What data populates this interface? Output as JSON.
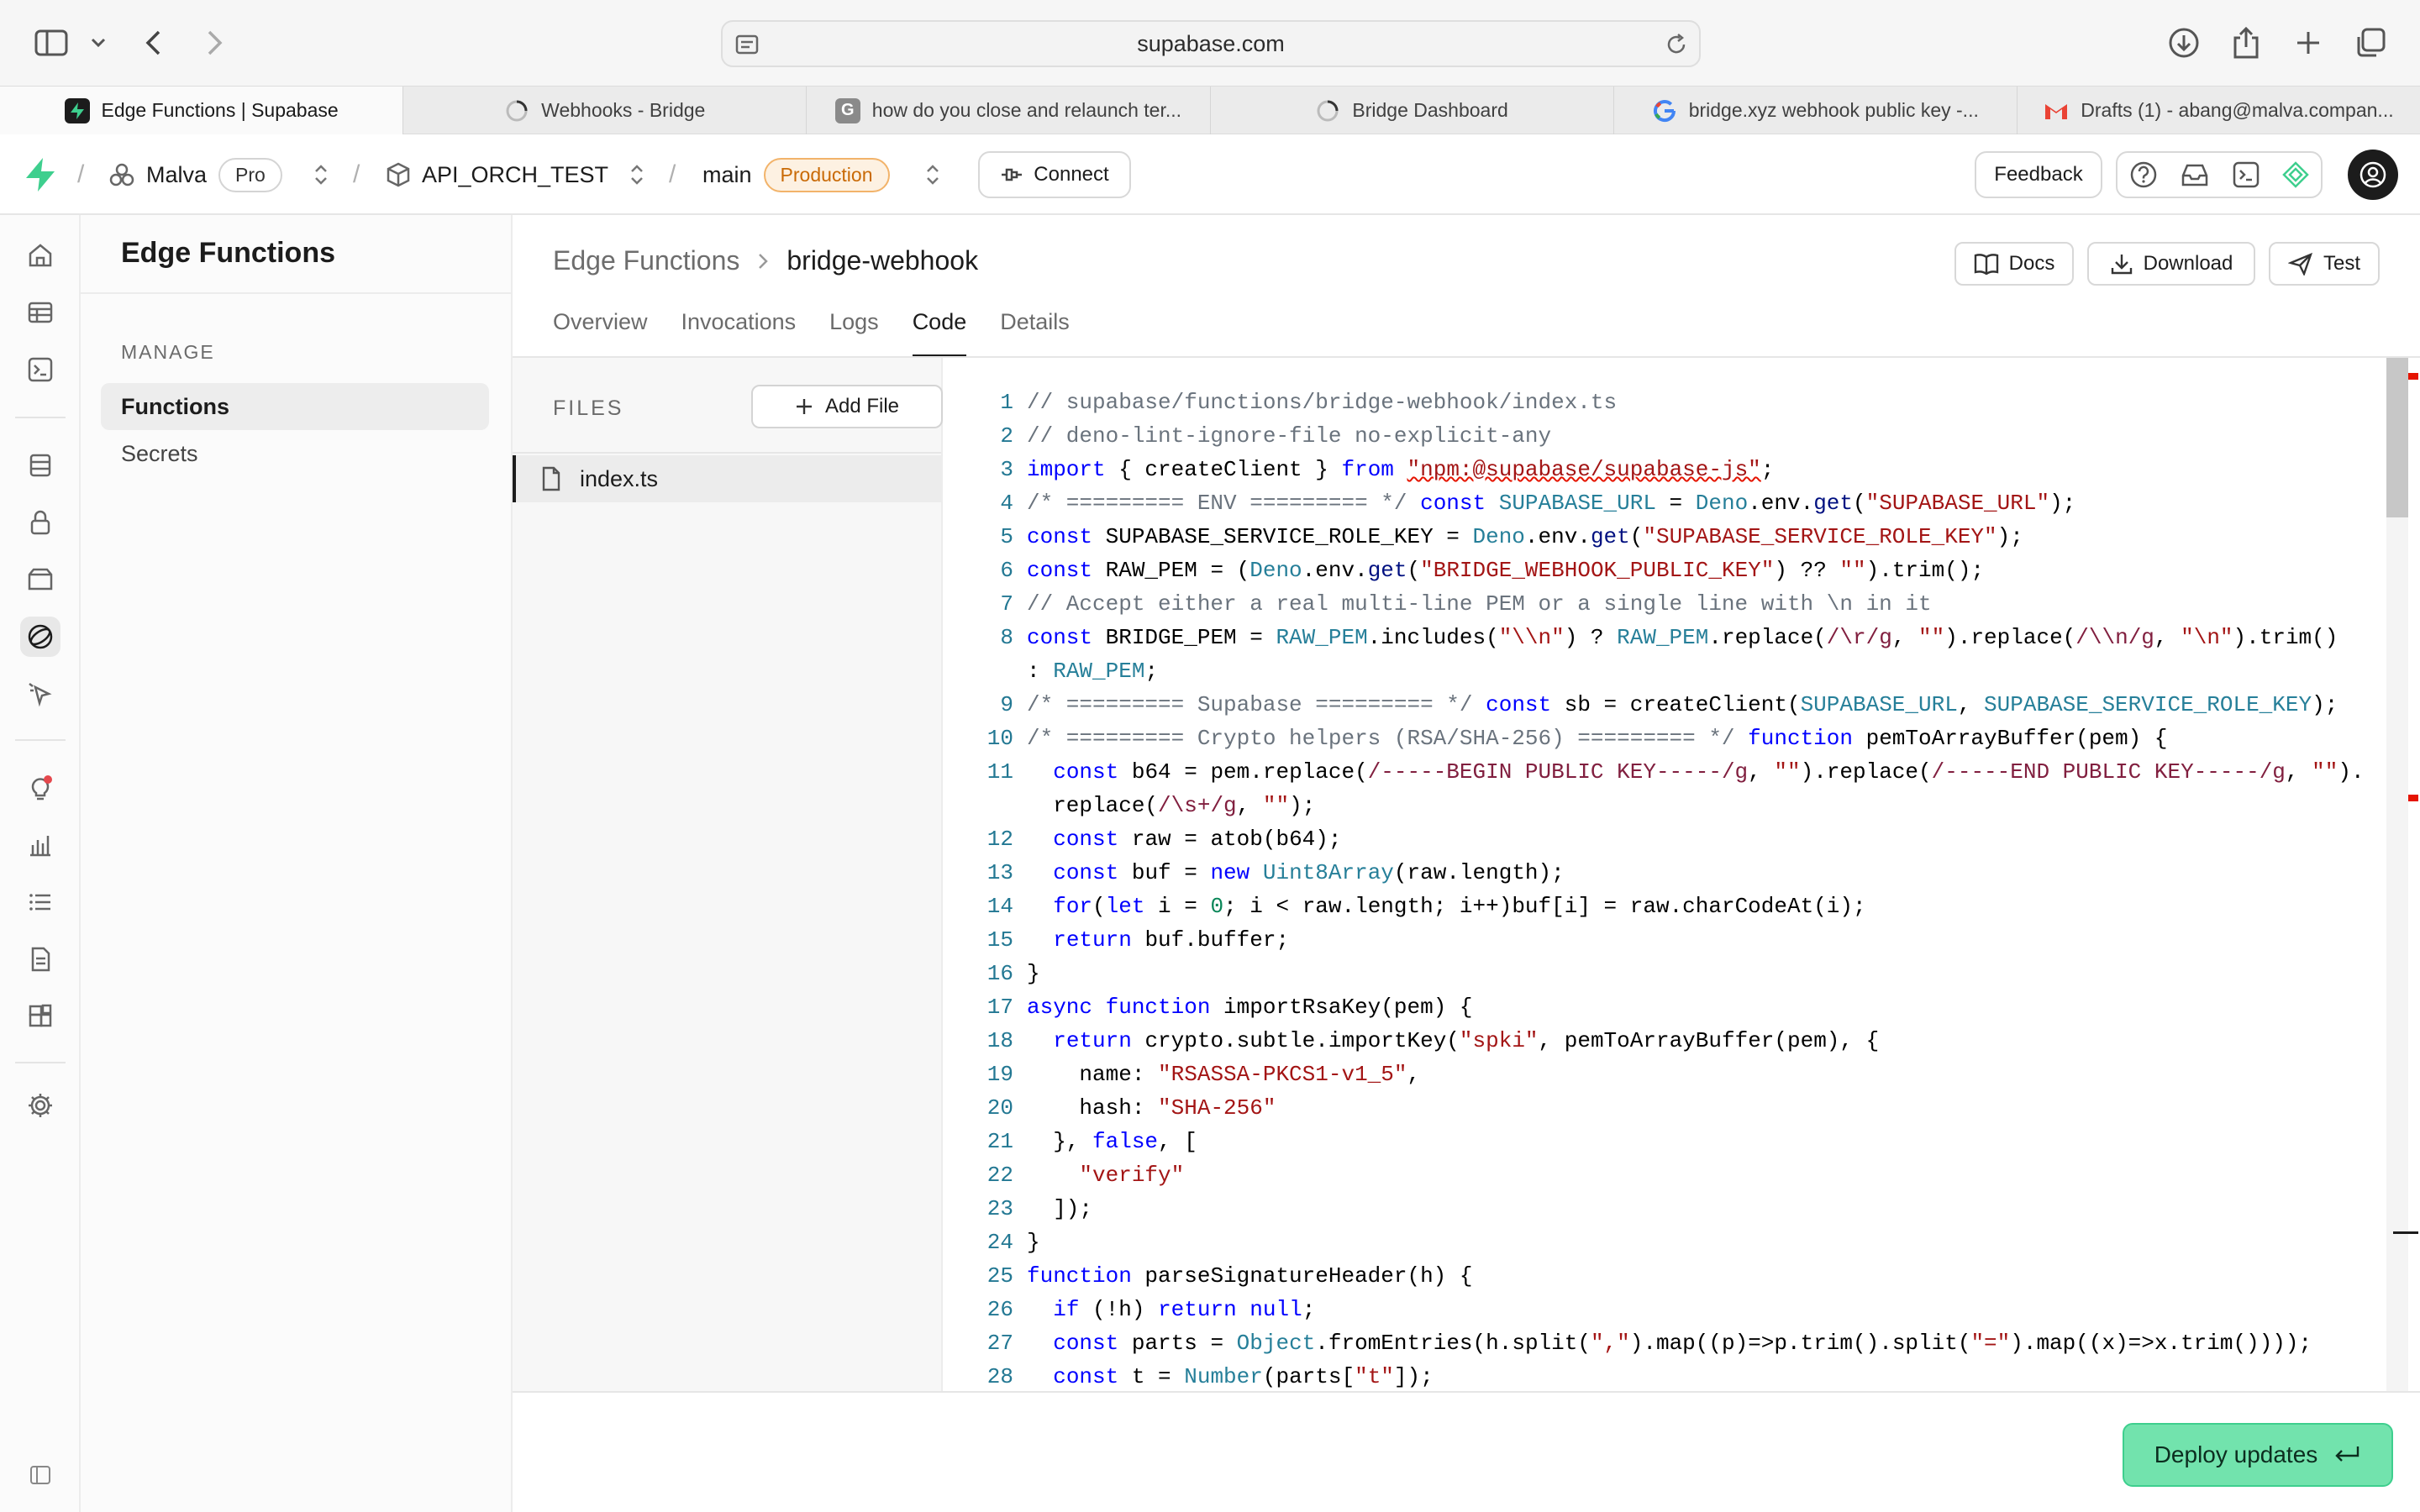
{
  "browser": {
    "url": "supabase.com",
    "tabs": [
      {
        "title": "Edge Functions | Supabase",
        "icon": "supabase-icon",
        "active": true
      },
      {
        "title": "Webhooks - Bridge",
        "icon": "loading-icon",
        "active": false
      },
      {
        "title": "how do you close and relaunch ter...",
        "icon": "g-icon",
        "active": false
      },
      {
        "title": "Bridge Dashboard",
        "icon": "loading-icon",
        "active": false
      },
      {
        "title": "bridge.xyz webhook public key  -...",
        "icon": "google-icon",
        "active": false
      },
      {
        "title": "Drafts (1) - abang@malva.compan...",
        "icon": "gmail-icon",
        "active": false
      }
    ]
  },
  "header": {
    "org": "Malva",
    "plan": "Pro",
    "project": "API_ORCH_TEST",
    "branch": "main",
    "env": "Production",
    "connect": "Connect",
    "feedback": "Feedback"
  },
  "sidebar": {
    "title": "Edge Functions",
    "section": "MANAGE",
    "items": [
      {
        "label": "Functions",
        "active": true
      },
      {
        "label": "Secrets",
        "active": false
      }
    ]
  },
  "main": {
    "breadcrumb": [
      "Edge Functions",
      "bridge-webhook"
    ],
    "actions": {
      "docs": "Docs",
      "download": "Download",
      "test": "Test"
    },
    "tabs": [
      {
        "label": "Overview",
        "active": false
      },
      {
        "label": "Invocations",
        "active": false
      },
      {
        "label": "Logs",
        "active": false
      },
      {
        "label": "Code",
        "active": true
      },
      {
        "label": "Details",
        "active": false
      }
    ],
    "files_header": "FILES",
    "add_file": "Add File",
    "file": "index.ts",
    "deploy": "Deploy updates"
  },
  "code": {
    "lines": [
      {
        "n": "1",
        "segs": [
          [
            "cm",
            "// supabase/functions/bridge-webhook/index.ts"
          ]
        ]
      },
      {
        "n": "2",
        "segs": [
          [
            "cm",
            "// deno-lint-ignore-file no-explicit-any"
          ]
        ]
      },
      {
        "n": "3",
        "segs": [
          [
            "kw",
            "import"
          ],
          [
            "",
            " { createClient } "
          ],
          [
            "kw",
            "from"
          ],
          [
            "",
            " "
          ],
          [
            "str sq",
            "\"npm:@supabase/supabase-js\""
          ],
          [
            "",
            ";"
          ]
        ]
      },
      {
        "n": "4",
        "segs": [
          [
            "cm",
            "/* ========= ENV ========= */"
          ],
          [
            "",
            " "
          ],
          [
            "kw",
            "const"
          ],
          [
            "",
            " "
          ],
          [
            "ty",
            "SUPABASE_URL"
          ],
          [
            "",
            " = "
          ],
          [
            "ty",
            "Deno"
          ],
          [
            "",
            ".env."
          ],
          [
            "id",
            "get"
          ],
          [
            "",
            "("
          ],
          [
            "str",
            "\"SUPABASE_URL\""
          ],
          [
            "",
            ");"
          ]
        ]
      },
      {
        "n": "5",
        "segs": [
          [
            "kw",
            "const"
          ],
          [
            "",
            " SUPABASE_SERVICE_ROLE_KEY = "
          ],
          [
            "ty",
            "Deno"
          ],
          [
            "",
            ".env."
          ],
          [
            "id",
            "get"
          ],
          [
            "",
            "("
          ],
          [
            "str",
            "\"SUPABASE_SERVICE_ROLE_KEY\""
          ],
          [
            "",
            ");"
          ]
        ]
      },
      {
        "n": "6",
        "segs": [
          [
            "kw",
            "const"
          ],
          [
            "",
            " RAW_PEM = ("
          ],
          [
            "ty",
            "Deno"
          ],
          [
            "",
            ".env."
          ],
          [
            "id",
            "get"
          ],
          [
            "",
            "("
          ],
          [
            "str",
            "\"BRIDGE_WEBHOOK_PUBLIC_KEY\""
          ],
          [
            "",
            ") ?? "
          ],
          [
            "str",
            "\"\""
          ],
          [
            "",
            ").trim();"
          ]
        ]
      },
      {
        "n": "7",
        "segs": [
          [
            "cm",
            "// Accept either a real multi-line PEM or a single line with \\n in it"
          ]
        ]
      },
      {
        "n": "8",
        "segs": [
          [
            "kw",
            "const"
          ],
          [
            "",
            " BRIDGE_PEM = "
          ],
          [
            "ty",
            "RAW_PEM"
          ],
          [
            "",
            ".includes("
          ],
          [
            "str",
            "\"\\\\n\""
          ],
          [
            "",
            ") ? "
          ],
          [
            "ty",
            "RAW_PEM"
          ],
          [
            "",
            ".replace("
          ],
          [
            "re",
            "/\\r/g"
          ],
          [
            "",
            ", "
          ],
          [
            "str",
            "\"\""
          ],
          [
            "",
            ").replace("
          ],
          [
            "re",
            "/\\\\n/g"
          ],
          [
            "",
            ", "
          ],
          [
            "str",
            "\"\\n\""
          ],
          [
            "",
            ").trim()"
          ]
        ]
      },
      {
        "n": "",
        "segs": [
          [
            "",
            ": "
          ],
          [
            "ty",
            "RAW_PEM"
          ],
          [
            "",
            ";"
          ]
        ]
      },
      {
        "n": "9",
        "segs": [
          [
            "cm",
            "/* ========= Supabase ========= */"
          ],
          [
            "",
            " "
          ],
          [
            "kw",
            "const"
          ],
          [
            "",
            " sb = createClient("
          ],
          [
            "ty",
            "SUPABASE_URL"
          ],
          [
            "",
            ", "
          ],
          [
            "ty",
            "SUPABASE_SERVICE_ROLE_KEY"
          ],
          [
            "",
            ");"
          ]
        ]
      },
      {
        "n": "10",
        "segs": [
          [
            "cm",
            "/* ========= Crypto helpers (RSA/SHA-256) ========= */"
          ],
          [
            "",
            " "
          ],
          [
            "kw",
            "function"
          ],
          [
            "",
            " pemToArrayBuffer(pem) {"
          ]
        ]
      },
      {
        "n": "11",
        "segs": [
          [
            "",
            "  "
          ],
          [
            "kw",
            "const"
          ],
          [
            "",
            " b64 = pem.replace("
          ],
          [
            "re",
            "/-----BEGIN PUBLIC KEY-----/g"
          ],
          [
            "",
            ", "
          ],
          [
            "str",
            "\"\""
          ],
          [
            "",
            ").replace("
          ],
          [
            "re",
            "/-----END PUBLIC KEY-----/g"
          ],
          [
            "",
            ", "
          ],
          [
            "str",
            "\"\""
          ],
          [
            "",
            ")."
          ]
        ]
      },
      {
        "n": "",
        "segs": [
          [
            "",
            "  replace("
          ],
          [
            "re",
            "/\\s+/g"
          ],
          [
            "",
            ", "
          ],
          [
            "str",
            "\"\""
          ],
          [
            "",
            ");"
          ]
        ]
      },
      {
        "n": "12",
        "segs": [
          [
            "",
            "  "
          ],
          [
            "kw",
            "const"
          ],
          [
            "",
            " raw = atob(b64);"
          ]
        ]
      },
      {
        "n": "13",
        "segs": [
          [
            "",
            "  "
          ],
          [
            "kw",
            "const"
          ],
          [
            "",
            " buf = "
          ],
          [
            "kw",
            "new"
          ],
          [
            "",
            " "
          ],
          [
            "ty",
            "Uint8Array"
          ],
          [
            "",
            "(raw.length);"
          ]
        ]
      },
      {
        "n": "14",
        "segs": [
          [
            "",
            "  "
          ],
          [
            "kw",
            "for"
          ],
          [
            "",
            "("
          ],
          [
            "kw",
            "let"
          ],
          [
            "",
            " i = "
          ],
          [
            "num",
            "0"
          ],
          [
            "",
            "; i < raw.length; i++)buf[i] = raw.charCodeAt(i);"
          ]
        ]
      },
      {
        "n": "15",
        "segs": [
          [
            "",
            "  "
          ],
          [
            "kw",
            "return"
          ],
          [
            "",
            " buf.buffer;"
          ]
        ]
      },
      {
        "n": "16",
        "segs": [
          [
            "",
            "}"
          ]
        ]
      },
      {
        "n": "17",
        "segs": [
          [
            "kw",
            "async"
          ],
          [
            "",
            " "
          ],
          [
            "kw",
            "function"
          ],
          [
            "",
            " importRsaKey(pem) {"
          ]
        ]
      },
      {
        "n": "18",
        "segs": [
          [
            "",
            "  "
          ],
          [
            "kw",
            "return"
          ],
          [
            "",
            " crypto.subtle.importKey("
          ],
          [
            "str",
            "\"spki\""
          ],
          [
            "",
            ", pemToArrayBuffer(pem), {"
          ]
        ]
      },
      {
        "n": "19",
        "segs": [
          [
            "",
            "    name: "
          ],
          [
            "str",
            "\"RSASSA-PKCS1-v1_5\""
          ],
          [
            "",
            ","
          ]
        ]
      },
      {
        "n": "20",
        "segs": [
          [
            "",
            "    hash: "
          ],
          [
            "str",
            "\"SHA-256\""
          ]
        ]
      },
      {
        "n": "21",
        "segs": [
          [
            "",
            "  }, "
          ],
          [
            "kw",
            "false"
          ],
          [
            "",
            ", ["
          ]
        ]
      },
      {
        "n": "22",
        "segs": [
          [
            "",
            "    "
          ],
          [
            "str",
            "\"verify\""
          ]
        ]
      },
      {
        "n": "23",
        "segs": [
          [
            "",
            "  ]);"
          ]
        ]
      },
      {
        "n": "24",
        "segs": [
          [
            "",
            "}"
          ]
        ]
      },
      {
        "n": "25",
        "segs": [
          [
            "kw",
            "function"
          ],
          [
            "",
            " parseSignatureHeader(h) {"
          ]
        ]
      },
      {
        "n": "26",
        "segs": [
          [
            "",
            "  "
          ],
          [
            "kw",
            "if"
          ],
          [
            "",
            " (!h) "
          ],
          [
            "kw",
            "return"
          ],
          [
            "",
            " "
          ],
          [
            "kw",
            "null"
          ],
          [
            "",
            ";"
          ]
        ]
      },
      {
        "n": "27",
        "segs": [
          [
            "",
            "  "
          ],
          [
            "kw",
            "const"
          ],
          [
            "",
            " parts = "
          ],
          [
            "ty",
            "Object"
          ],
          [
            "",
            ".fromEntries(h.split("
          ],
          [
            "str",
            "\",\""
          ],
          [
            "",
            ").map((p)=>p.trim().split("
          ],
          [
            "str",
            "\"=\""
          ],
          [
            "",
            ").map((x)=>x.trim())));"
          ]
        ]
      },
      {
        "n": "28",
        "segs": [
          [
            "",
            "  "
          ],
          [
            "kw",
            "const"
          ],
          [
            "",
            " t = "
          ],
          [
            "ty",
            "Number"
          ],
          [
            "",
            "(parts["
          ],
          [
            "str",
            "\"t\""
          ],
          [
            "",
            "]);"
          ]
        ]
      }
    ]
  },
  "colors": {
    "brand": "#3ecf8e",
    "deploy_bg": "#72e3ad",
    "production_text": "#c96a06"
  }
}
